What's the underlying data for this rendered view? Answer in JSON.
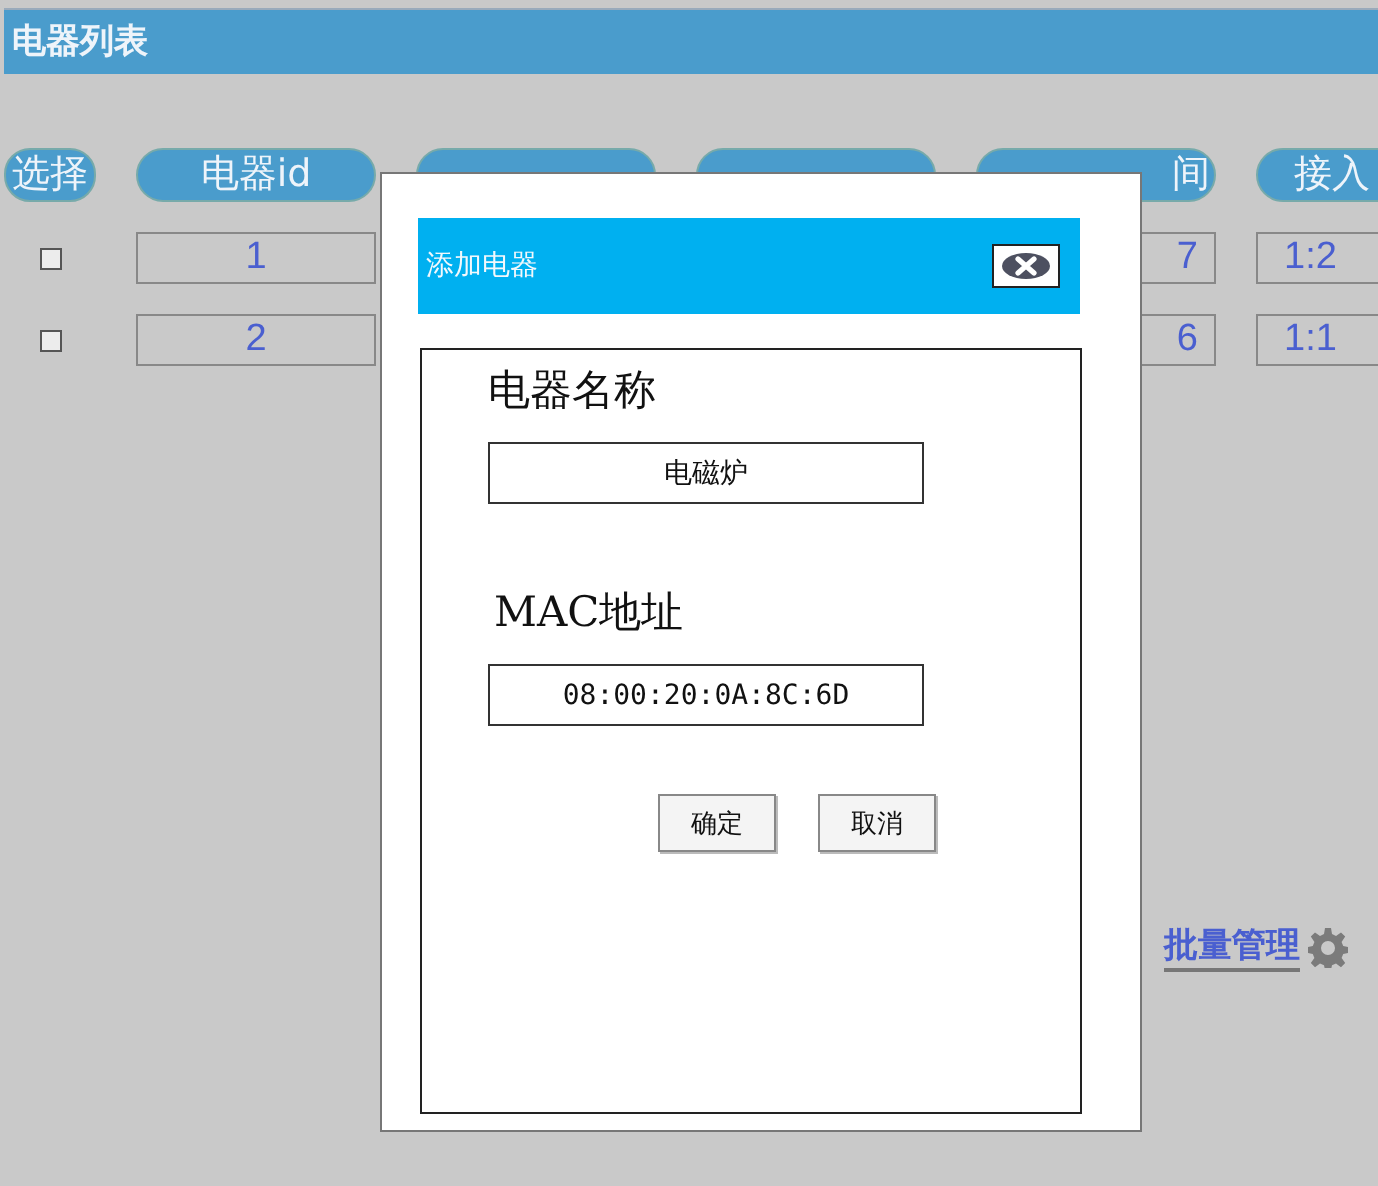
{
  "page_title": "电器列表",
  "table": {
    "columns": [
      {
        "label": "选择"
      },
      {
        "label": "电器id"
      },
      {
        "label": "间"
      },
      {
        "label": "接入"
      }
    ],
    "rows": [
      {
        "checked": false,
        "id": "1",
        "column_5": "7",
        "column_6": "1:2"
      },
      {
        "checked": false,
        "id": "2",
        "column_5": "6",
        "column_6": "1:1"
      }
    ]
  },
  "batch_link": "批量管理",
  "dialog": {
    "title": "添加电器",
    "fields": [
      {
        "label": "电器名称",
        "value": "电磁炉"
      },
      {
        "label": "MAC地址",
        "value": "08:00:20:0A:8C:6D"
      }
    ],
    "buttons": [
      "确定",
      "取消"
    ]
  }
}
